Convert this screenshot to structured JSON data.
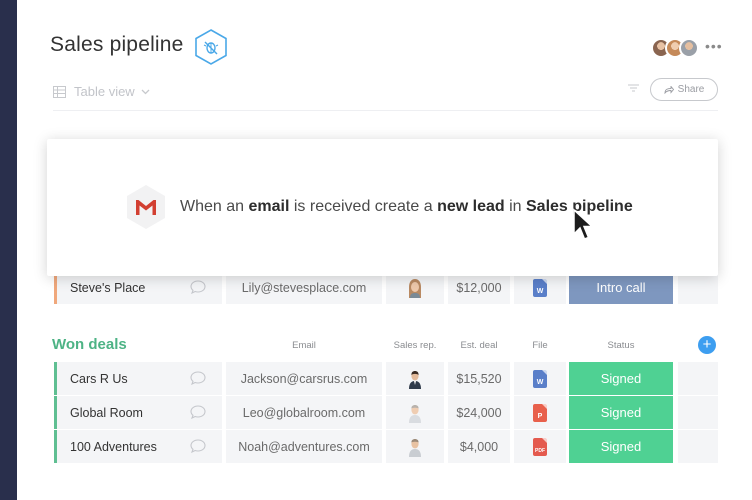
{
  "board": {
    "title": "Sales pipeline",
    "view_label": "Table view",
    "share_label": "Share"
  },
  "popup": {
    "gmail_logo_letter": "M",
    "parts": [
      "When an",
      "email",
      "is received create a",
      "new lead",
      "in",
      "Sales pipeline"
    ]
  },
  "lead_row": {
    "name": "Steve's Place",
    "email": "Lily@stevesplace.com",
    "deal": "$12,000",
    "file": "W",
    "status": "Intro call"
  },
  "won_group": {
    "title": "Won deals",
    "columns": {
      "email": "Email",
      "rep": "Sales rep.",
      "deal": "Est. deal",
      "file": "File",
      "status": "Status"
    },
    "add_label": "+",
    "rows": [
      {
        "name": "Cars R Us",
        "email": "Jackson@carsrus.com",
        "deal": "$15,520",
        "file": "W",
        "status": "Signed"
      },
      {
        "name": "Global Room",
        "email": "Leo@globalroom.com",
        "deal": "$24,000",
        "file": "P",
        "status": "Signed"
      },
      {
        "name": "100 Adventures",
        "email": "Noah@adventures.com",
        "deal": "$4,000",
        "file": "PDF",
        "status": "Signed"
      }
    ]
  },
  "colors": {
    "rail": "#292f4c",
    "signed": "#4fd193",
    "intro_call": "#7e97bf",
    "group_green": "#4db385",
    "add_blue": "#3d9ef0"
  },
  "icons": [
    "hexagon-bug-icon",
    "table-icon",
    "chevron-down-icon",
    "filter-icon",
    "share-arrow-icon",
    "more-icon",
    "chat-bubble-icon",
    "gmail-icon",
    "cursor-icon",
    "word-file-icon",
    "powerpoint-file-icon",
    "pdf-file-icon"
  ]
}
